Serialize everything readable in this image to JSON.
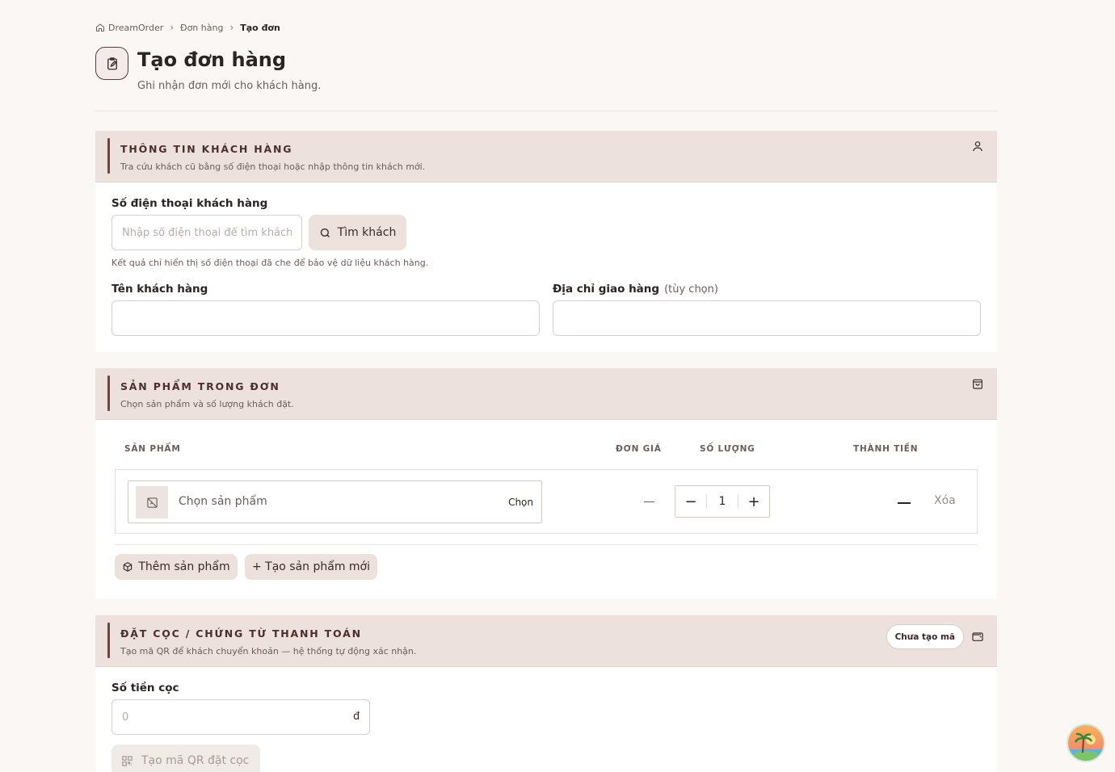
{
  "breadcrumb": {
    "home": "DreamOrder",
    "orders": "Đơn hàng",
    "current": "Tạo đơn"
  },
  "page": {
    "title": "Tạo đơn hàng",
    "subtitle": "Ghi nhận đơn mới cho khách hàng."
  },
  "customer": {
    "title": "THÔNG TIN KHÁCH HÀNG",
    "description": "Tra cứu khách cũ bằng số điện thoại hoặc nhập thông tin khách mới.",
    "phone_label": "Số điện thoại khách hàng",
    "phone_placeholder": "Nhập số điện thoại để tìm khách",
    "find_button": "Tìm khách",
    "hint": "Kết quả chỉ hiển thị số điện thoại đã che để bảo vệ dữ liệu khách hàng.",
    "name_label": "Tên khách hàng",
    "address_label": "Địa chỉ giao hàng",
    "address_optional": "(tùy chọn)",
    "icon": "user-icon"
  },
  "products": {
    "title": "SẢN PHẨM TRONG ĐƠN",
    "description": "Chọn sản phẩm và số lượng khách đặt.",
    "columns": {
      "product": "SẢN PHẨM",
      "price": "ĐƠN GIÁ",
      "qty": "SỐ LƯỢNG",
      "total": "THÀNH TIỀN"
    },
    "row": {
      "placeholder": "Chọn sản phẩm",
      "choose": "Chọn",
      "quantity": "1",
      "delete": "Xóa"
    },
    "add_button": "Thêm sản phẩm",
    "create_button": "+ Tạo sản phẩm mới",
    "icon": "shopping-bag-icon"
  },
  "deposit": {
    "title": "ĐẶT CỌC / CHỨNG TỪ THANH TOÁN",
    "description": "Tạo mã QR để khách chuyển khoản — hệ thống tự động xác nhận.",
    "status": "Chưa tạo mã",
    "amount_label": "Số tiền cọc",
    "amount_placeholder": "0",
    "currency": "đ",
    "qr_button": "Tạo mã QR đặt cọc",
    "icon": "wallet-icon"
  },
  "colors": {
    "accent": "#6d4541",
    "section_header": "#ece1dc",
    "background": "#faf7f4"
  }
}
